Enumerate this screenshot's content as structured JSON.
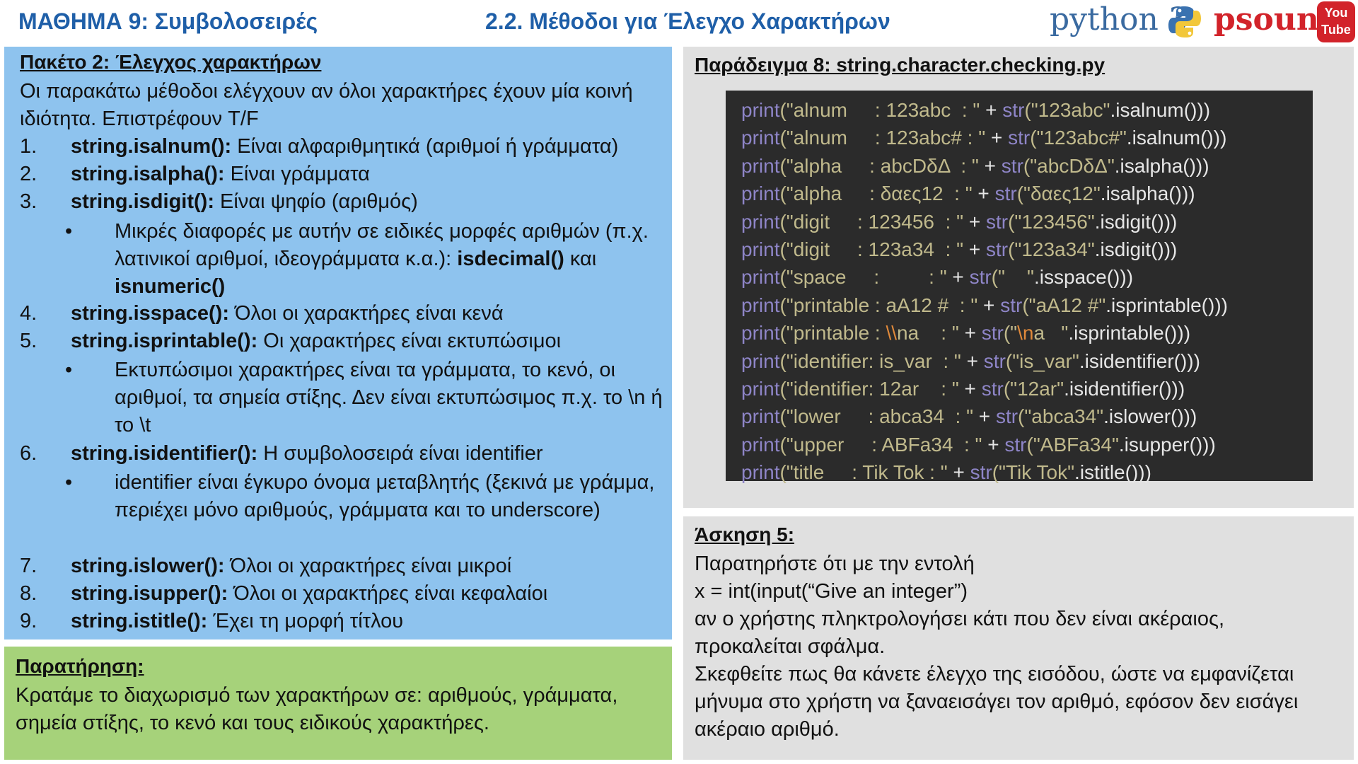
{
  "header": {
    "lesson_title": "ΜΑΘΗΜΑ 9: Συμβολοσειρές",
    "section_title": "2.2. Μέθοδοι για Έλεγχο Χαρακτήρων",
    "python_logo": "python 3",
    "psounis_logo": "psounis",
    "youtube_top": "You",
    "youtube_bottom": "Tube"
  },
  "methods": {
    "heading": "Πακέτο 2: Έλεγχος χαρακτήρων",
    "intro": "Οι παρακάτω μέθοδοι ελέγχουν αν όλοι χαρακτήρες έχουν μία κοινή ιδιότητα. Επιστρέφουν T/F",
    "items": [
      {
        "num": "1.",
        "code": "string.isalnum():",
        "desc": " Είναι αλφαριθμητικά (αριθμοί ή γράμματα)"
      },
      {
        "num": "2.",
        "code": "string.isalpha():",
        "desc": " Είναι γράμματα"
      },
      {
        "num": "3.",
        "code": "string.isdigit():",
        "desc": " Είναι ψηφίο (αριθμός)"
      },
      {
        "num": "4.",
        "code": "string.isspace():",
        "desc": " Όλοι οι χαρακτήρες είναι κενά"
      },
      {
        "num": "5.",
        "code": "string.isprintable():",
        "desc": " Οι χαρακτήρες είναι εκτυπώσιμοι"
      },
      {
        "num": "6.",
        "code": "string.isidentifier():",
        "desc": " Η συμβολοσειρά είναι identifier"
      },
      {
        "num": "7.",
        "code": "string.islower():",
        "desc": " Όλοι οι χαρακτήρες είναι μικροί"
      },
      {
        "num": "8.",
        "code": "string.isupper():",
        "desc": " Όλοι οι χαρακτήρες είναι κεφαλαίοι"
      },
      {
        "num": "9.",
        "code": "string.istitle():",
        "desc": " Έχει τη μορφή τίτλου"
      }
    ],
    "bullet_digit": {
      "text": "Μικρές διαφορές με αυτήν σε ειδικές μορφές αριθμών (π.χ. λατινικοί αριθμοί, ιδεογράμματα κ.α.): ",
      "code1": "isdecimal()",
      "mid": " και ",
      "code2": "isnumeric()"
    },
    "bullet_printable": "Εκτυπώσιμοι χαρακτήρες είναι τα γράμματα, το κενό, οι αριθμοί, τα σημεία στίξης. Δεν είναι εκτυπώσιμος π.χ. το \\n ή το \\t",
    "bullet_identifier": "identifier είναι έγκυρο όνομα μεταβλητής (ξεκινά με γράμμα, περιέχει μόνο αριθμούς, γράμματα και το underscore)",
    "bullet_symbol": "•"
  },
  "note": {
    "heading": "Παρατήρηση:",
    "text": "Κρατάμε το διαχωρισμό των χαρακτήρων σε: αριθμούς, γράμματα, σημεία στίξης, το κενό και τους ειδικούς χαρακτήρες."
  },
  "example": {
    "heading": "Παράδειγμα 8: string.character.checking.py",
    "code_lines": [
      [
        [
          "kw",
          "print"
        ],
        [
          "str",
          "(\"alnum     : 123abc  : \""
        ],
        [
          "op",
          " + "
        ],
        [
          "kw",
          "str"
        ],
        [
          "str",
          "(\"123abc\""
        ],
        [
          "op",
          ".isalnum()))"
        ]
      ],
      [
        [
          "kw",
          "print"
        ],
        [
          "str",
          "(\"alnum     : 123abc# : \""
        ],
        [
          "op",
          " + "
        ],
        [
          "kw",
          "str"
        ],
        [
          "str",
          "(\"123abc#\""
        ],
        [
          "op",
          ".isalnum()))"
        ]
      ],
      [
        [
          "kw",
          "print"
        ],
        [
          "str",
          "(\"alpha     : abcDδΔ  : \""
        ],
        [
          "op",
          " + "
        ],
        [
          "kw",
          "str"
        ],
        [
          "str",
          "(\"abcDδΔ\""
        ],
        [
          "op",
          ".isalpha()))"
        ]
      ],
      [
        [
          "kw",
          "print"
        ],
        [
          "str",
          "(\"alpha     : δαες12  : \""
        ],
        [
          "op",
          " + "
        ],
        [
          "kw",
          "str"
        ],
        [
          "str",
          "(\"δαες12\""
        ],
        [
          "op",
          ".isalpha()))"
        ]
      ],
      [
        [
          "kw",
          "print"
        ],
        [
          "str",
          "(\"digit     : 123456  : \""
        ],
        [
          "op",
          " + "
        ],
        [
          "kw",
          "str"
        ],
        [
          "str",
          "(\"123456\""
        ],
        [
          "op",
          ".isdigit()))"
        ]
      ],
      [
        [
          "kw",
          "print"
        ],
        [
          "str",
          "(\"digit     : 123a34  : \""
        ],
        [
          "op",
          " + "
        ],
        [
          "kw",
          "str"
        ],
        [
          "str",
          "(\"123a34\""
        ],
        [
          "op",
          ".isdigit()))"
        ]
      ],
      [
        [
          "kw",
          "print"
        ],
        [
          "str",
          "(\"space     :         : \""
        ],
        [
          "op",
          " + "
        ],
        [
          "kw",
          "str"
        ],
        [
          "str",
          "(\"    \""
        ],
        [
          "op",
          ".isspace()))"
        ]
      ],
      [
        [
          "kw",
          "print"
        ],
        [
          "str",
          "(\"printable : aA12 #  : \""
        ],
        [
          "op",
          " + "
        ],
        [
          "kw",
          "str"
        ],
        [
          "str",
          "(\"aA12 #\""
        ],
        [
          "op",
          ".isprintable()))"
        ]
      ],
      [
        [
          "kw",
          "print"
        ],
        [
          "str",
          "(\"printable : "
        ],
        [
          "esc",
          "\\\\"
        ],
        [
          "str",
          "na    : \""
        ],
        [
          "op",
          " + "
        ],
        [
          "kw",
          "str"
        ],
        [
          "str",
          "(\""
        ],
        [
          "esc",
          "\\n"
        ],
        [
          "str",
          "a   \""
        ],
        [
          "op",
          ".isprintable()))"
        ]
      ],
      [
        [
          "kw",
          "print"
        ],
        [
          "str",
          "(\"identifier: is_var  : \""
        ],
        [
          "op",
          " + "
        ],
        [
          "kw",
          "str"
        ],
        [
          "str",
          "(\"is_var\""
        ],
        [
          "op",
          ".isidentifier()))"
        ]
      ],
      [
        [
          "kw",
          "print"
        ],
        [
          "str",
          "(\"identifier: 12ar    : \""
        ],
        [
          "op",
          " + "
        ],
        [
          "kw",
          "str"
        ],
        [
          "str",
          "(\"12ar\""
        ],
        [
          "op",
          ".isidentifier()))"
        ]
      ],
      [
        [
          "kw",
          "print"
        ],
        [
          "str",
          "(\"lower     : abca34  : \""
        ],
        [
          "op",
          " + "
        ],
        [
          "kw",
          "str"
        ],
        [
          "str",
          "(\"abca34\""
        ],
        [
          "op",
          ".islower()))"
        ]
      ],
      [
        [
          "kw",
          "print"
        ],
        [
          "str",
          "(\"upper     : ABFa34  : \""
        ],
        [
          "op",
          " + "
        ],
        [
          "kw",
          "str"
        ],
        [
          "str",
          "(\"ABFa34\""
        ],
        [
          "op",
          ".isupper()))"
        ]
      ],
      [
        [
          "kw",
          "print"
        ],
        [
          "str",
          "(\"title     : Tik Tok : \""
        ],
        [
          "op",
          " + "
        ],
        [
          "kw",
          "str"
        ],
        [
          "str",
          "(\"Tik Tok\""
        ],
        [
          "op",
          ".istitle()))"
        ]
      ]
    ]
  },
  "exercise": {
    "heading": "Άσκηση 5:",
    "lines": [
      "Παρατηρήστε ότι με την εντολή",
      "x = int(input(“Give an integer”)",
      "αν ο χρήστης πληκτρολογήσει κάτι που δεν είναι ακέραιος,",
      "προκαλείται σφάλμα.",
      "Σκεφθείτε πως θα κάνετε έλεγχο της εισόδου, ώστε να εμφανίζεται",
      "μήνυμα στο χρήστη να ξαναεισάγει τον αριθμό, εφόσον δεν εισάγει",
      "ακέραιο αριθμό."
    ]
  },
  "colors": {
    "title_blue": "#1f5fa8",
    "methods_bg": "#8ec3ee",
    "note_bg": "#a6d27a",
    "gray_bg": "#e0e0e0",
    "code_bg": "#2b2b2b",
    "code_keyword": "#8e85c7",
    "code_string": "#c0b98c",
    "code_escape": "#e0893a",
    "brand_red": "#d2232a"
  },
  "icons": [
    "python-icon",
    "youtube-icon"
  ]
}
